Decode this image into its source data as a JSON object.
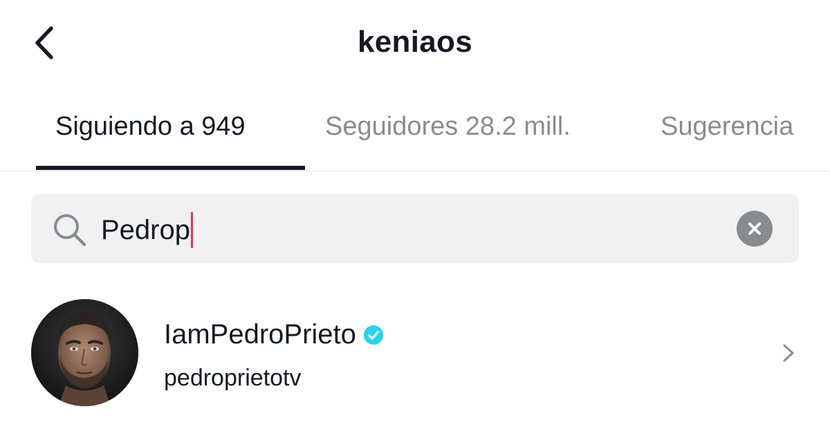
{
  "header": {
    "title": "keniaos",
    "back_icon": "chevron-left-icon"
  },
  "tabs": [
    {
      "label": "Siguiendo a 949",
      "active": true
    },
    {
      "label": "Seguidores 28.2 mill.",
      "active": false
    },
    {
      "label": "Sugerencia",
      "active": false
    }
  ],
  "search": {
    "value": "Pedrop",
    "icon": "search-icon",
    "clear_icon": "clear-icon",
    "caret_color": "#fe2c55"
  },
  "results": [
    {
      "display_name": "IamPedroPrieto",
      "username": "pedroprietotv",
      "verified": true,
      "verified_color": "#20d5ec",
      "chevron_icon": "chevron-right-icon"
    }
  ],
  "colors": {
    "text_primary": "#161823",
    "text_secondary": "#8a8b91",
    "search_bg": "#f1f1f2",
    "accent": "#fe2c55"
  }
}
